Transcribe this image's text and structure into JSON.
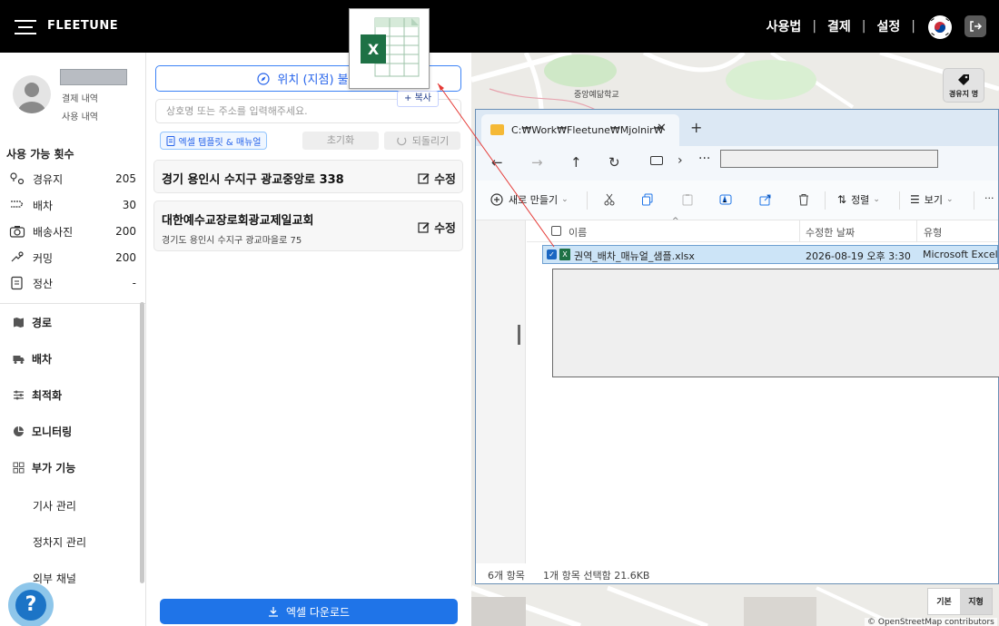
{
  "topbar": {
    "brand": "FLEETUNE",
    "nav": [
      "사용법",
      "결제",
      "설정"
    ],
    "separator": "|"
  },
  "sidebar": {
    "links": [
      "결제 내역",
      "사용 내역"
    ],
    "section_title": "사용 가능 횟수",
    "counts": [
      {
        "label": "경유지",
        "value": "205",
        "icon": "waypoint-icon"
      },
      {
        "label": "배차",
        "value": "30",
        "icon": "dispatch-icon"
      },
      {
        "label": "배송사진",
        "value": "200",
        "icon": "camera-icon"
      },
      {
        "label": "커밍",
        "value": "200",
        "icon": "hand-icon"
      },
      {
        "label": "정산",
        "value": "-",
        "icon": "receipt-icon"
      }
    ],
    "menus": [
      {
        "label": "경로",
        "icon": "map-icon"
      },
      {
        "label": "배차",
        "icon": "truck-icon"
      },
      {
        "label": "최적화",
        "icon": "sliders-icon"
      },
      {
        "label": "모니터링",
        "icon": "pie-chart-icon"
      },
      {
        "label": "부가 기능",
        "icon": "grid-icon"
      }
    ],
    "submenus": [
      "기사 관리",
      "정차지 관리",
      "외부 채널"
    ],
    "help": "?"
  },
  "panel": {
    "load_button": "위치 (지점) 불러",
    "search_placeholder": "상호명 또는 주소를 입력해주세요.",
    "copy_badge": "+ 복사",
    "template_button": "엑셀 템플릿 & 매뉴얼",
    "reset_button": "초기화",
    "undo_button": "되돌리기",
    "cards": [
      {
        "title": "경기 용인시 수지구 광교중앙로 338",
        "subtitle": "",
        "edit": "수정"
      },
      {
        "title": "대한예수교장로회광교제일교회",
        "subtitle": "경기도 용인시 수지구 광교마을로 75",
        "edit": "수정"
      }
    ],
    "download_button": "엑셀 다운로드"
  },
  "map": {
    "label": "중앙예닮학교",
    "waypoint_button": "경유지 명",
    "type_options": [
      "기본",
      "지형"
    ],
    "attribution": "© OpenStreetMap contributors"
  },
  "explorer": {
    "tab_path": "C:₩Work₩Fleetune₩Mjolnir₩",
    "toolbar": {
      "new_label": "새로 만들기",
      "sort_label": "정렬",
      "view_label": "보기",
      "more": "···"
    },
    "columns": [
      "이름",
      "수정한 날짜",
      "유형"
    ],
    "file": {
      "name": "권역_배차_매뉴얼_샘플.xlsx",
      "modified": "2026-08-19 오후 3:30",
      "type": "Microsoft Excel ..."
    },
    "status": {
      "count": "6개 항목",
      "selected": "1개 항목 선택함 21.6KB"
    }
  },
  "colors": {
    "accent_blue": "#1f74e8",
    "topbar": "#000000",
    "excel_green": "#1e7145",
    "drag_arrow": "#e53935"
  }
}
